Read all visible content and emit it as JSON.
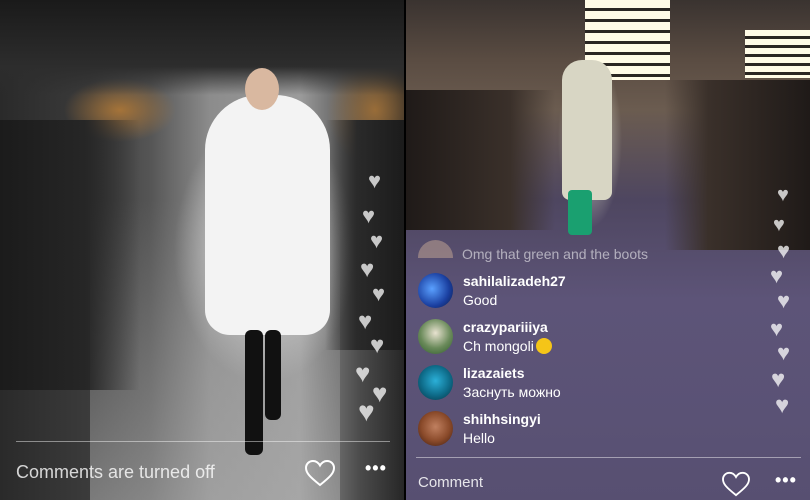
{
  "left_stream": {
    "comments_status": "Comments are turned off",
    "like_icon": "heart-outline-icon",
    "more_icon": "more-horizontal-icon"
  },
  "right_stream": {
    "faded_comment": "Omg that green and the boots",
    "comments": [
      {
        "username": "sahilalizadeh27",
        "message": "Good",
        "avatar_color": "#1a3fa0"
      },
      {
        "username": "crazypariiiya",
        "message": "Ch mongoli",
        "avatar_color": "#2c5a2a"
      },
      {
        "username": "lizazaiets",
        "message": "Заснуть можно",
        "avatar_color": "#0e6c8a"
      },
      {
        "username": "shihhsingyi",
        "message": "Hello",
        "avatar_color": "#8a4a2a"
      }
    ],
    "comment_placeholder": "Comment",
    "like_icon": "heart-outline-icon",
    "more_icon": "more-horizontal-icon"
  }
}
